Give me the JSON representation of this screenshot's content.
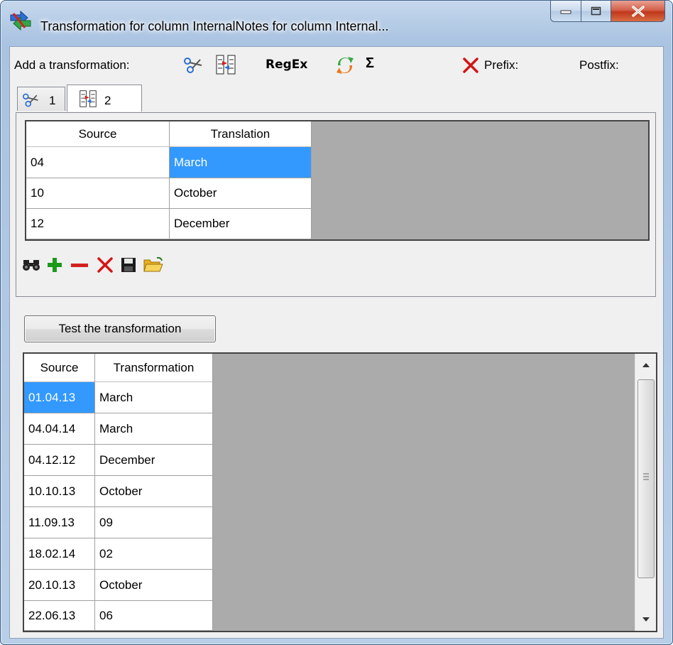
{
  "window": {
    "title": "Transformation for column InternalNotes for column Internal..."
  },
  "toolbar": {
    "add_label": "Add a transformation:",
    "regex_label": "RegEx",
    "sigma_label": "Σ",
    "prefix_label": "Prefix:",
    "postfix_label": "Postfix:",
    "icons": [
      "scissors-icon",
      "translate-columns-icon",
      "regex",
      "swap-arrows-icon",
      "sigma-icon",
      "delete-red-x-icon"
    ]
  },
  "tabs": [
    {
      "label": "1",
      "icon": "scissors-icon"
    },
    {
      "label": "2",
      "icon": "translate-columns-icon"
    }
  ],
  "translation_grid": {
    "columns": [
      "Source",
      "Translation"
    ],
    "rows": [
      {
        "source": "04",
        "translation": "March"
      },
      {
        "source": "10",
        "translation": "October"
      },
      {
        "source": "12",
        "translation": "December"
      }
    ]
  },
  "grid_toolbar": {
    "icons": [
      "binoculars-icon",
      "add-plus-icon",
      "remove-minus-icon",
      "delete-x-icon",
      "save-disk-icon",
      "open-folder-icon"
    ]
  },
  "test_button": {
    "label": "Test the transformation"
  },
  "result_grid": {
    "columns": [
      "Source",
      "Transformation"
    ],
    "rows": [
      {
        "source": "01.04.13",
        "transformation": "March"
      },
      {
        "source": "04.04.14",
        "transformation": "March"
      },
      {
        "source": "04.12.12",
        "transformation": "December"
      },
      {
        "source": "10.10.13",
        "transformation": "October"
      },
      {
        "source": "11.09.13",
        "transformation": "09"
      },
      {
        "source": "18.02.14",
        "transformation": "02"
      },
      {
        "source": "20.10.13",
        "transformation": "October"
      },
      {
        "source": "22.06.13",
        "transformation": "06"
      }
    ]
  },
  "colors": {
    "selection": "#3399ff",
    "grid_background": "#ababab",
    "close_button": "#c7432b",
    "add_icon": "#1a9a1a",
    "remove_icon": "#d42020"
  }
}
